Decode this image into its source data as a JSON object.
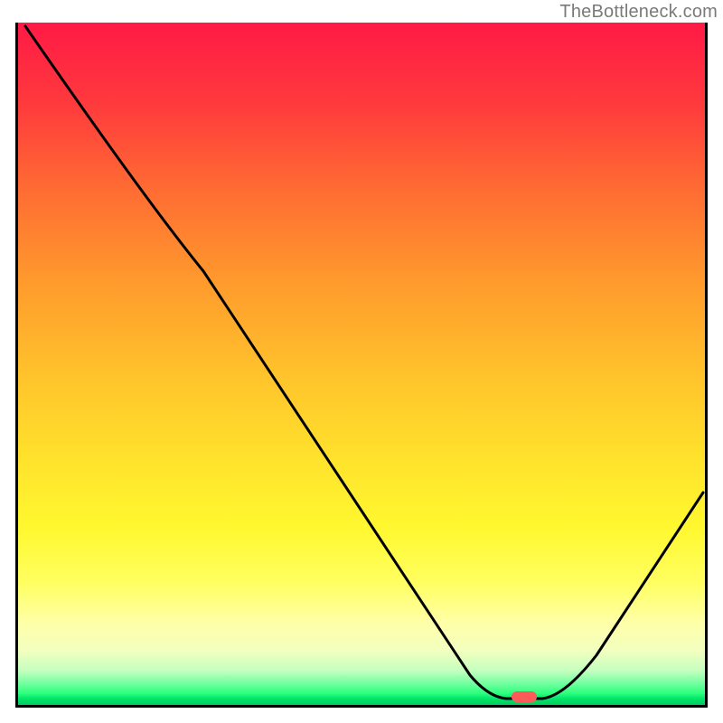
{
  "watermark": "TheBottleneck.com",
  "chart_data": {
    "type": "line",
    "title": "",
    "xlabel": "",
    "ylabel": "",
    "xlim": [
      0,
      100
    ],
    "ylim": [
      0,
      100
    ],
    "x": [
      0,
      6,
      12,
      18,
      24,
      30,
      36,
      42,
      48,
      54,
      60,
      66,
      70,
      74,
      78,
      82,
      86,
      90,
      95,
      100
    ],
    "values": [
      100,
      92,
      84,
      76,
      68,
      58,
      47,
      36,
      25,
      14,
      5,
      1,
      0,
      0,
      0,
      2,
      8,
      17,
      30,
      44
    ],
    "marker": {
      "x": 72,
      "y": 0,
      "color": "#ff5555"
    },
    "background_gradient": {
      "top_color": "#ff1a46",
      "mid_color": "#ffe22c",
      "bottom_color": "#00cc5c"
    }
  }
}
